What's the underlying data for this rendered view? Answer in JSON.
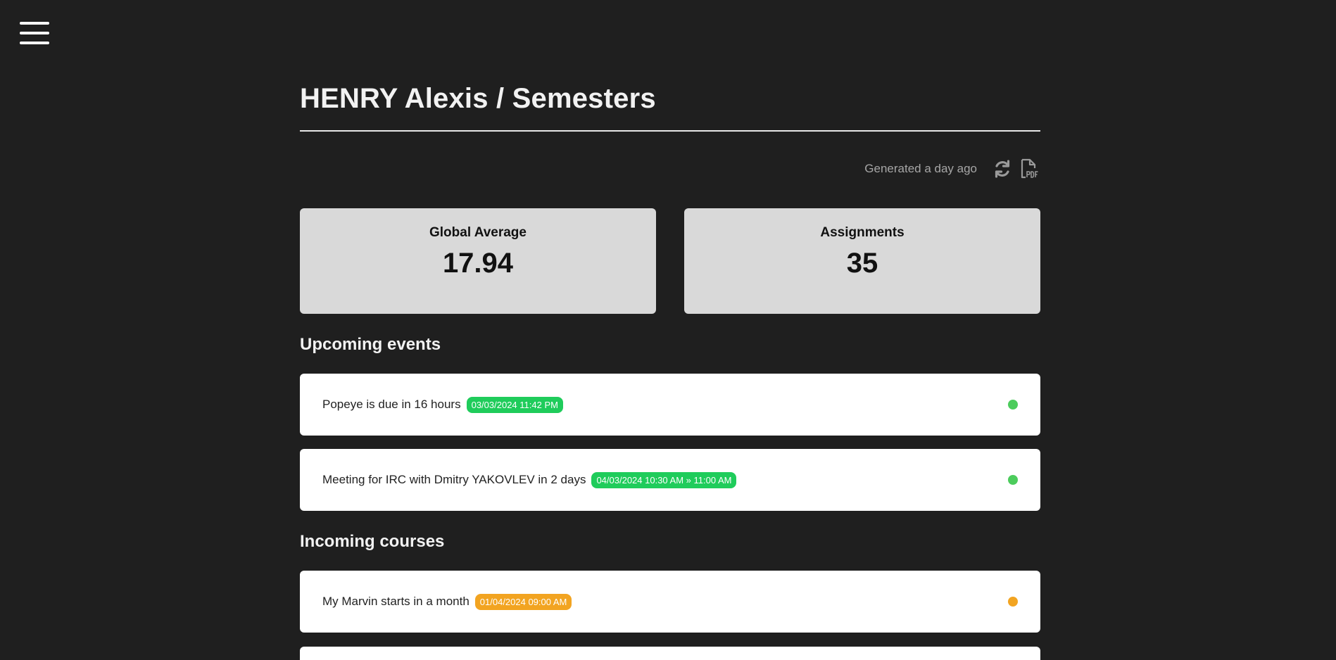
{
  "header": {
    "title": "HENRY Alexis / Semesters",
    "generated": "Generated a day ago"
  },
  "icons": {
    "menu": "hamburger-menu-icon",
    "refresh": "refresh-icon",
    "pdf": "pdf-file-icon"
  },
  "stats": {
    "global_average": {
      "label": "Global Average",
      "value": "17.94"
    },
    "assignments": {
      "label": "Assignments",
      "value": "35"
    }
  },
  "upcoming_events": {
    "title": "Upcoming events",
    "items": [
      {
        "text": "Popeye is due in 16 hours",
        "badge": "03/03/2024 11:42 PM",
        "status_color": "#4ccc5c"
      },
      {
        "text": "Meeting for IRC with Dmitry YAKOVLEV in 2 days",
        "badge": "04/03/2024 10:30 AM » 11:00 AM",
        "status_color": "#4ccc5c"
      }
    ]
  },
  "incoming_courses": {
    "title": "Incoming courses",
    "items": [
      {
        "text": "My Marvin starts in a month",
        "badge": "01/04/2024 09:00 AM",
        "status_color": "#f2a421"
      }
    ]
  },
  "colors": {
    "background": "#1f1f1f",
    "card": "#d9d9d9",
    "event_card": "#ffffff",
    "green": "#1fcc5b",
    "orange": "#f2a421"
  }
}
